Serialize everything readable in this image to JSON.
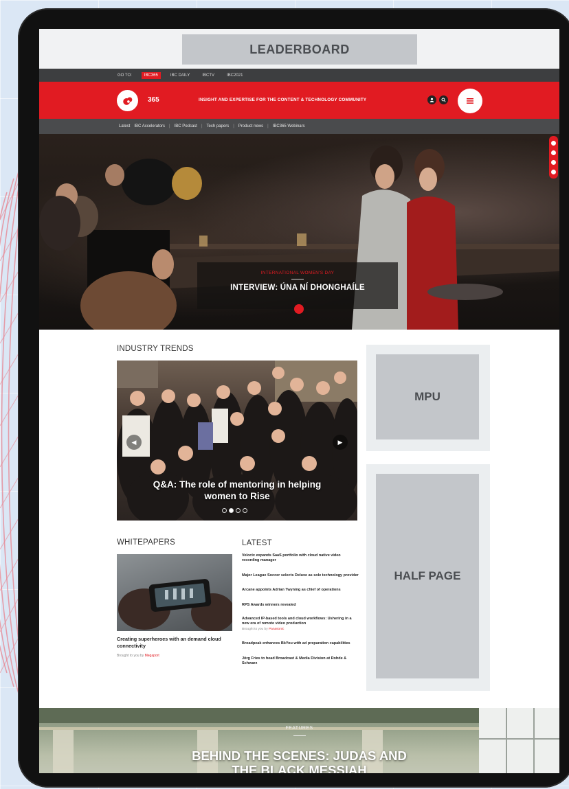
{
  "leaderboard_label": "LEADERBOARD",
  "topbar": {
    "items": [
      "GO TO:",
      "IBC365",
      "IBC DAILY",
      "IBCTV",
      "IBC2021"
    ]
  },
  "header": {
    "logo_text": "365",
    "tagline": "INSIGHT AND EXPERTISE FOR THE CONTENT & TECHNOLOGY COMMUNITY",
    "icons": [
      "user-icon",
      "search-icon",
      "menu-icon"
    ]
  },
  "subnav": {
    "items": [
      "Latest",
      "IBC Accelerators",
      "IBC Podcast",
      "Tech papers",
      "Product news",
      "IBC365 Webinars"
    ]
  },
  "hero": {
    "kicker": "INTERNATIONAL WOMEN'S DAY",
    "title": "INTERVIEW: ÚNA NÍ DHONGHAÍLE"
  },
  "industry_trends": {
    "heading": "INDUSTRY TRENDS",
    "caption_line1": "Q&A: The role of mentoring in helping",
    "caption_line2": "women to Rise"
  },
  "whitepapers": {
    "heading": "WHITEPAPERS",
    "title": "Creating superheroes with an demand cloud connectivity",
    "sponsor_prefix": "Brought to you by",
    "sponsor": "Megaport"
  },
  "latest": {
    "heading": "LATEST",
    "items": [
      {
        "text": "Velocix expands SaaS portfolio with cloud native video recording manager"
      },
      {
        "text": "Major League Soccer selects Deluxe as sole technology provider"
      },
      {
        "text": "Arcane appoints Adrian Twyning as chief of operations"
      },
      {
        "text": "RPS Awards winners revealed"
      },
      {
        "text": "Advanced IP-based tools and cloud workflows: Ushering in a new era of remote video production",
        "sponsor_prefix": "Brought to you by",
        "sponsor": "Panasonic"
      },
      {
        "text": "Broadpeak enhances BkYou with ad preparation capabilities"
      },
      {
        "text": "Jörg Fries to head Broadcast & Media Division at Rohde & Schwarz"
      }
    ]
  },
  "ads": {
    "mpu": "MPU",
    "half_page": "HALF PAGE"
  },
  "features": {
    "kicker": "FEATURES",
    "title_line1": "BEHIND THE SCENES: JUDAS AND",
    "title_line2": "THE BLACK MESSIAH"
  },
  "colors": {
    "brand_red": "#e11b22",
    "dark_bar": "#3d3e40",
    "ad_grey": "#c3c6ca"
  }
}
